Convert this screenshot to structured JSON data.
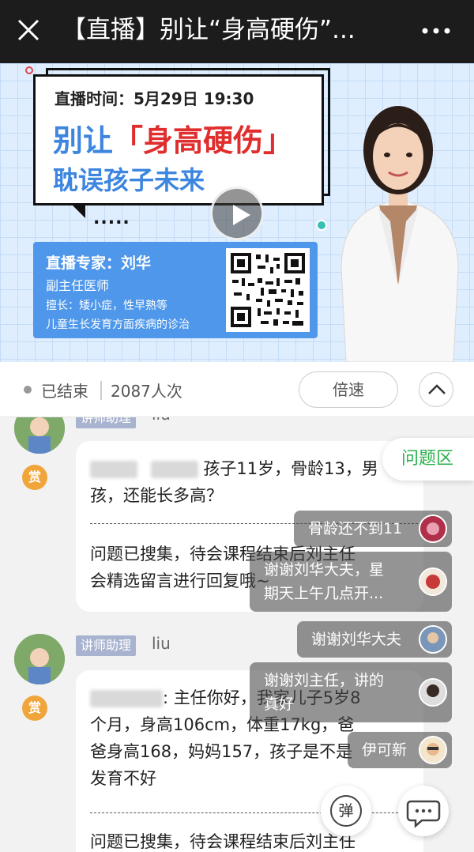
{
  "header": {
    "title": "【直播】别让“身高硬伤”...",
    "close_icon": "close-icon",
    "more_icon": "more-dots-icon"
  },
  "banner": {
    "live_time": "直播时间：5月29日 19:30",
    "headline_prefix": "别让",
    "headline_highlight": "「身高硬伤」",
    "headline_line2": "耽误孩子未来",
    "dots": ".....",
    "expert_name": "直播专家：刘华",
    "expert_role": "副主任医师",
    "expert_specialty": "擅长：矮小症，性早熟等",
    "expert_specialty2": "儿童生长发育方面疾病的诊治",
    "play_icon": "play-icon",
    "colors": {
      "blue": "#3d86e0",
      "red": "#e02e2e",
      "card": "#4e97ea"
    }
  },
  "status": {
    "state": "已结束",
    "viewers": "2087人次",
    "speed_label": "倍速",
    "collapse_icon": "chevron-up-icon"
  },
  "question_tab": "问题区",
  "messages": [
    {
      "role": "讲师助理",
      "author": "liu",
      "reward": "赏",
      "question_line1": "孩子11岁，骨龄13，男",
      "question_line2": "孩，还能长多高？",
      "answer_line1": "问题已搜集，待会课程结束后刘主任",
      "answer_line2": "会精选留言进行回复哦~"
    },
    {
      "role": "讲师助理",
      "author": "liu",
      "reward": "赏",
      "question_line1": ": 主任你好，我家儿子5岁8",
      "question_line2": "个月，身高106cm，体重17kg，爸",
      "question_line3": "爸身高168，妈妈157，孩子是不是",
      "question_line4": "发育不好",
      "answer_line1": "问题已搜集，待会课程结束后刘主任"
    }
  ],
  "danmaku": [
    {
      "text": "骨龄还不到11"
    },
    {
      "text": "谢谢刘华大夫，星",
      "text2": "期天上午几点开..."
    },
    {
      "text": "谢谢刘华大夫"
    },
    {
      "text": "谢谢刘主任，讲的",
      "text2": "真好"
    },
    {
      "text": "伊可新"
    }
  ],
  "footer": {
    "danmu_label": "弹",
    "comment_icon": "comment-bubble-icon"
  },
  "accent": "#2bb14d"
}
